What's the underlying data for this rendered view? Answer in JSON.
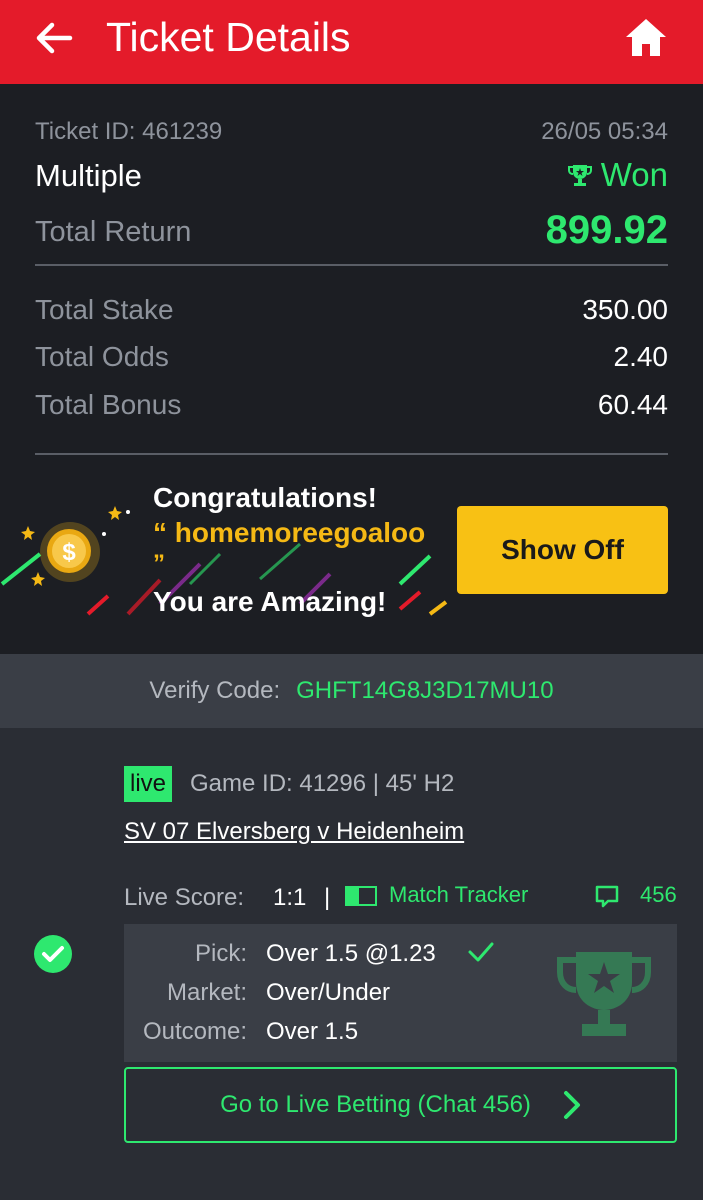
{
  "header": {
    "title": "Ticket Details",
    "back_icon": "arrow-left-icon",
    "home_icon": "home-icon"
  },
  "ticket": {
    "id_label": "Ticket ID: 461239",
    "date": "26/05 05:34",
    "type": "Multiple",
    "status": "Won",
    "total_return_label": "Total Return",
    "total_return_value": "899.92",
    "rows": [
      {
        "label": "Total Stake",
        "value": "350.00"
      },
      {
        "label": "Total Odds",
        "value": "2.40"
      },
      {
        "label": "Total Bonus",
        "value": "60.44"
      }
    ]
  },
  "promo": {
    "title": "Congratulations!",
    "user": "“ homemoreegoaloo",
    "quote_close": "”",
    "subtitle": "You are Amazing!",
    "button": "Show Off"
  },
  "verify": {
    "label": "Verify Code:",
    "code": "GHFT14G8J3D17MU10"
  },
  "match": {
    "live_badge": "live",
    "game_id": "Game ID: 41296 | 45' H2",
    "teams": "SV 07 Elversberg v Heidenheim",
    "live_score_label": "Live Score:",
    "live_score": "1:1",
    "separator": "|",
    "tracker": "Match Tracker",
    "chat_count": "456",
    "pick_label": "Pick:",
    "pick_value": "Over 1.5 @1.23",
    "market_label": "Market:",
    "market_value": "Over/Under",
    "outcome_label": "Outcome:",
    "outcome_value": "Over 1.5",
    "go_live": "Go to Live Betting (Chat 456)"
  },
  "colors": {
    "header": "#e41b2a",
    "accent_green": "#2ee86f",
    "button_yellow": "#f8c114",
    "panel_dark": "#1c1e23"
  }
}
